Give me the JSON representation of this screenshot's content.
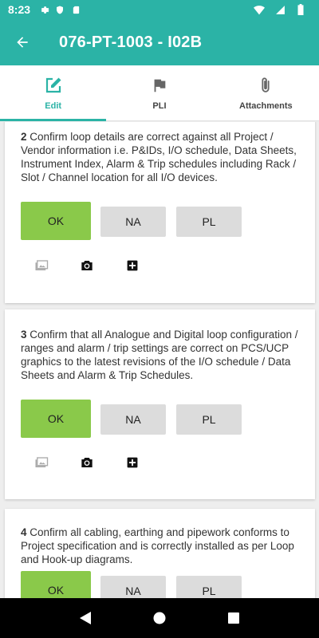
{
  "status_bar": {
    "time": "8:23"
  },
  "app_bar": {
    "title": "076-PT-1003 - I02B"
  },
  "tabs": [
    {
      "label": "Edit",
      "icon": "edit-icon"
    },
    {
      "label": "PLI",
      "icon": "flag-icon"
    },
    {
      "label": "Attachments",
      "icon": "paperclip-icon"
    }
  ],
  "items": [
    {
      "number": "2",
      "text": "Confirm loop details are correct against all Project / Vendor information i.e. P&IDs, I/O schedule, Data Sheets, Instrument Index, Alarm & Trip schedules including Rack / Slot / Channel location for all I/O devices.",
      "buttons": [
        "OK",
        "NA",
        "PL"
      ]
    },
    {
      "number": "3",
      "text": "Confirm that all Analogue and Digital loop configuration / ranges and alarm / trip settings are correct on PCS/UCP graphics to the latest revisions of the I/O schedule / Data Sheets and Alarm & Trip Schedules.",
      "buttons": [
        "OK",
        "NA",
        "PL"
      ]
    },
    {
      "number": "4",
      "text": "Confirm all cabling, earthing and pipework conforms to Project specification and is correctly installed as per Loop and Hook-up diagrams.",
      "buttons": [
        "OK",
        "NA",
        "PL"
      ]
    }
  ],
  "colors": {
    "accent": "#2bb3a6",
    "ok_selected": "#8ac94a",
    "button_default": "#dcdcdc"
  }
}
